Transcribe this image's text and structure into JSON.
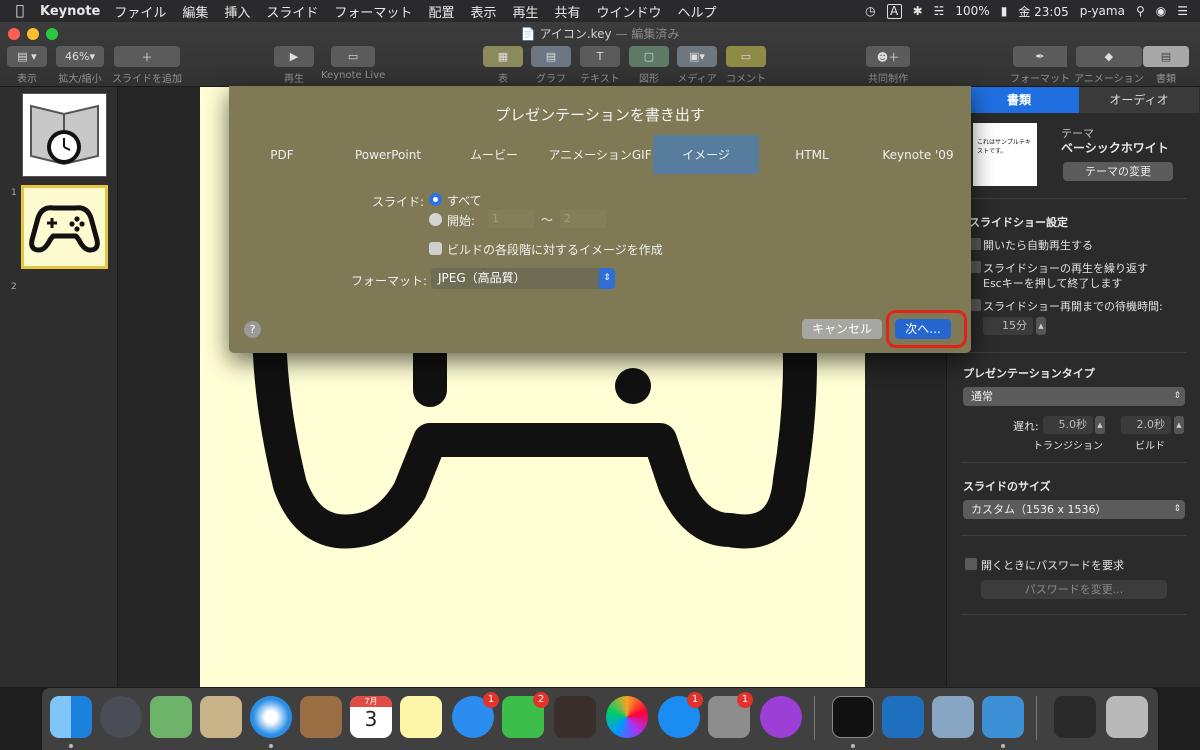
{
  "menubar": {
    "app": "Keynote",
    "items": [
      "ファイル",
      "編集",
      "挿入",
      "スライド",
      "フォーマット",
      "配置",
      "表示",
      "再生",
      "共有",
      "ウインドウ",
      "ヘルプ"
    ],
    "battery": "100%",
    "clock": "金 23:05",
    "user": "p-yama",
    "input_indicator": "A"
  },
  "window": {
    "title": "アイコン.key",
    "subtitle": "— 編集済み"
  },
  "toolbar": {
    "view": "表示",
    "zoom_value": "46%",
    "zoom_label": "拡大/縮小",
    "add_slide": "スライドを追加",
    "play": "再生",
    "keynote_live": "Keynote Live",
    "table": "表",
    "chart": "グラフ",
    "text": "テキスト",
    "shape": "図形",
    "media": "メディア",
    "comment": "コメント",
    "collaborate": "共同制作",
    "format": "フォーマット",
    "animate": "アニメーション",
    "document": "書類"
  },
  "slides": [
    "1",
    "2"
  ],
  "dialog": {
    "title": "プレゼンテーションを書き出す",
    "tabs": [
      "PDF",
      "PowerPoint",
      "ムービー",
      "アニメーションGIF",
      "イメージ",
      "HTML",
      "Keynote '09"
    ],
    "active_tab": "イメージ",
    "slides_label": "スライド:",
    "all": "すべて",
    "from": "開始:",
    "from_value": "1",
    "to_sep": "〜",
    "to_value": "2",
    "builds": "ビルドの各段階に対するイメージを作成",
    "format_label": "フォーマット:",
    "format_value": "JPEG（高品質）",
    "help": "?",
    "cancel": "キャンセル",
    "next": "次へ..."
  },
  "inspector": {
    "tabs": [
      "書類",
      "オーディオ"
    ],
    "theme_label": "テーマ",
    "theme_name": "ベーシックホワイト",
    "theme_preview": "これはサンプルテキストです。",
    "change_theme": "テーマの変更",
    "slideshow_settings": "スライドショー設定",
    "autoplay": "開いたら自動再生する",
    "loop": "スライドショーの再生を繰り返す",
    "esc_note": "Escキーを押して終了します",
    "restart": "スライドショー再開までの待機時間:",
    "restart_value": "15分",
    "pres_type": "プレゼンテーションタイプ",
    "pres_value": "通常",
    "delay": "遅れ:",
    "transition_value": "5.0秒",
    "build_value": "2.0秒",
    "transition": "トランジション",
    "build": "ビルド",
    "slide_size": "スライドのサイズ",
    "slide_size_value": "カスタム（1536 x 1536）",
    "password": "開くときにパスワードを要求",
    "change_password": "パスワードを変更..."
  },
  "dock": {
    "calendar_month": "7月",
    "calendar_day": "3",
    "badges": [
      "1",
      "2",
      "1",
      "1"
    ]
  }
}
